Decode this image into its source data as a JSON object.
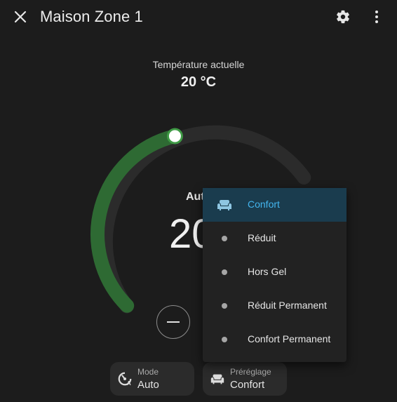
{
  "header": {
    "title": "Maison Zone 1",
    "close_icon": "close-icon",
    "settings_icon": "gear-icon",
    "more_icon": "dots-vertical-icon"
  },
  "current_temperature": {
    "label": "Température actuelle",
    "value": "20 °C"
  },
  "thermostat": {
    "mode_text": "Aut",
    "target_text": "20",
    "target_fraction": 0.45,
    "accent_color": "#2e6a33",
    "track_color": "#2b2b2b",
    "minus_icon": "minus-icon"
  },
  "chips": {
    "mode": {
      "label": "Mode",
      "value": "Auto",
      "icon": "thermostat-auto-icon"
    },
    "preset": {
      "label": "Préréglage",
      "value": "Confort",
      "icon": "sofa-icon"
    }
  },
  "preset_menu": {
    "selected_color": "#43b5ee",
    "items": [
      {
        "label": "Confort",
        "icon": "sofa-icon",
        "selected": true
      },
      {
        "label": "Réduit",
        "icon": "dot-icon",
        "selected": false
      },
      {
        "label": "Hors Gel",
        "icon": "dot-icon",
        "selected": false
      },
      {
        "label": "Réduit Permanent",
        "icon": "dot-icon",
        "selected": false
      },
      {
        "label": "Confort Permanent",
        "icon": "dot-icon",
        "selected": false
      }
    ]
  }
}
